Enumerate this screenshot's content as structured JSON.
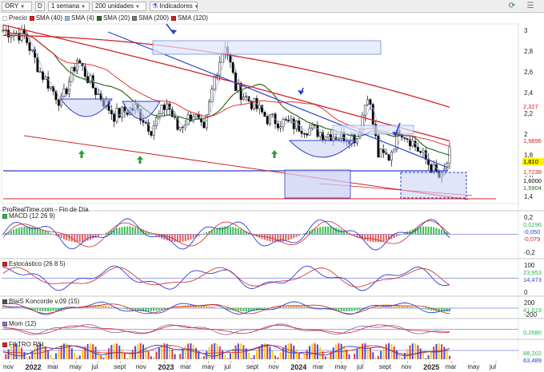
{
  "toolbar": {
    "symbol": "ORY",
    "d_button": "D",
    "interval": "1 semana",
    "units": "200 unidades",
    "indicators": "Indicadores"
  },
  "legend": [
    {
      "label": "Precio",
      "color": "#ffffff"
    },
    {
      "label": "SMA (40)",
      "color": "#e02020"
    },
    {
      "label": "SMA (4)",
      "color": "#9bb7e8"
    },
    {
      "label": "SMA (20)",
      "color": "#2f6b1e"
    },
    {
      "label": "SMA (200)",
      "color": "#7a7a7a"
    },
    {
      "label": "SMA (120)",
      "color": "#d22424"
    }
  ],
  "footer": "ProRealTime.com - Fin de Día",
  "price_axis": {
    "ticks": [
      "3",
      "2,8",
      "2,6",
      "2,4",
      "2,2",
      "2",
      "1,8",
      "1,6",
      "1,4"
    ]
  },
  "price_tags": [
    {
      "text": "2,327",
      "bg": "#ffffff",
      "fg": "#d22424"
    },
    {
      "text": "1,9896",
      "bg": "#ffffff",
      "fg": "#d22424"
    },
    {
      "text": "1,810",
      "bg": "#fff200",
      "fg": "#000000"
    },
    {
      "text": "1,7238",
      "bg": "#ffffff",
      "fg": "#d22424"
    },
    {
      "text": "1,6000",
      "bg": "#ffffff",
      "fg": "#000000"
    },
    {
      "text": "1,5904",
      "bg": "#ffffff",
      "fg": "#2f6b1e"
    }
  ],
  "panes": [
    {
      "title": "MACD (12 26 9)",
      "color": "#2fb54a",
      "ticks": [
        "0,2",
        "-0,2"
      ],
      "tags": [
        "0,0296",
        "-0,050",
        "-0,079"
      ]
    },
    {
      "title": "Estocástico (26 8 5)",
      "color": "#d22424",
      "ticks": [
        "100",
        "0"
      ],
      "tags": [
        "23,953",
        "14,473"
      ]
    },
    {
      "title": "BlaiS Koncorde v.09 (15)",
      "color": "#555555",
      "ticks": [
        "200",
        "-200"
      ],
      "tags": [
        "41,619"
      ]
    },
    {
      "title": "Mom (12)",
      "color": "#8e6fb5",
      "ticks": [],
      "tags": [
        "0,2680"
      ]
    },
    {
      "title": "FILTRO RSI",
      "color": "#d22424",
      "ticks": [],
      "tags": [
        "88,202",
        "63,489"
      ]
    }
  ],
  "x_axis": [
    {
      "label": "nov",
      "bold": false
    },
    {
      "label": "2022",
      "bold": true
    },
    {
      "label": "mar",
      "bold": false
    },
    {
      "label": "may",
      "bold": false
    },
    {
      "label": "jul",
      "bold": false
    },
    {
      "label": "sept",
      "bold": false
    },
    {
      "label": "nov",
      "bold": false
    },
    {
      "label": "2023",
      "bold": true
    },
    {
      "label": "mar",
      "bold": false
    },
    {
      "label": "may",
      "bold": false
    },
    {
      "label": "jul",
      "bold": false
    },
    {
      "label": "sept",
      "bold": false
    },
    {
      "label": "nov",
      "bold": false
    },
    {
      "label": "2024",
      "bold": true
    },
    {
      "label": "mar",
      "bold": false
    },
    {
      "label": "may",
      "bold": false
    },
    {
      "label": "jul",
      "bold": false
    },
    {
      "label": "sept",
      "bold": false
    },
    {
      "label": "nov",
      "bold": false
    },
    {
      "label": "2025",
      "bold": true
    },
    {
      "label": "mar",
      "bold": false
    },
    {
      "label": "may",
      "bold": false
    },
    {
      "label": "jul",
      "bold": false
    }
  ],
  "colors": {
    "candle_up": "#ffffff",
    "candle_down": "#000000",
    "trend_blue": "#2c3fcc",
    "trend_red": "#d22424",
    "box_fill": "#c9cff5"
  },
  "icons": {
    "arrow_up": "green-up-arrow",
    "arrow_down": "blue-down-arrow",
    "refresh": "refresh-icon"
  }
}
